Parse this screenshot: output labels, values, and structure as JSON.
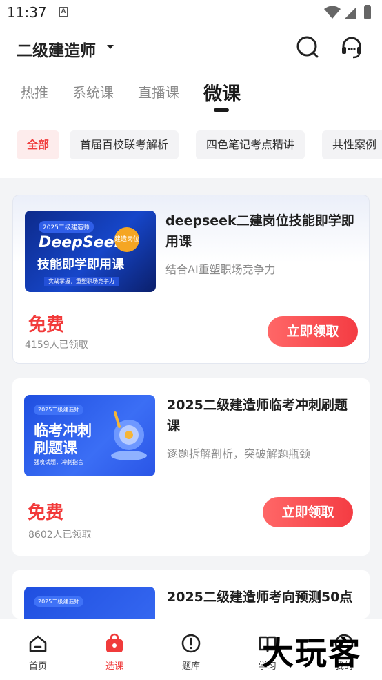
{
  "status_bar": {
    "time": "11:37",
    "notification_icon": "A"
  },
  "header": {
    "title": "二级建造师",
    "search_icon": "search-icon",
    "service_icon": "headset-icon"
  },
  "tabs": [
    {
      "label": "热推",
      "active": false
    },
    {
      "label": "系统课",
      "active": false
    },
    {
      "label": "直播课",
      "active": false
    },
    {
      "label": "微课",
      "active": true
    }
  ],
  "chips": [
    {
      "label": "全部",
      "active": true
    },
    {
      "label": "首届百校联考解析",
      "active": false
    },
    {
      "label": "四色笔记考点精讲",
      "active": false
    },
    {
      "label": "共性案例",
      "active": false
    }
  ],
  "courses": [
    {
      "title": "deepseek二建岗位技能即学即用课",
      "subtitle": "结合AI重塑职场竞争力",
      "price": "免费",
      "count": "4159人已领取",
      "cta": "立即领取",
      "thumb": {
        "tag": "2025二级建造师",
        "line1": "DeepSeek",
        "line2": "技能即学即用课",
        "badge": "建造岗位",
        "footer": "实战掌握，重塑职场竞争力"
      }
    },
    {
      "title": "2025二级建造师临考冲刺刷题课",
      "subtitle": "逐题拆解剖析，突破解题瓶颈",
      "price": "免费",
      "count": "8602人已领取",
      "cta": "立即领取",
      "thumb": {
        "tag": "2025二级建造师",
        "line1": "临考冲刺",
        "line2": "刷题课",
        "footer": "强攻试题，冲刺指言"
      }
    },
    {
      "title": "2025二级建造师考向预测50点",
      "thumb": {
        "tag": "2025二级建造师"
      }
    }
  ],
  "tabbar": [
    {
      "label": "首页",
      "icon": "home-icon",
      "active": false
    },
    {
      "label": "选课",
      "icon": "shopping-bag-icon",
      "active": true
    },
    {
      "label": "题库",
      "icon": "question-bank-icon",
      "active": false
    },
    {
      "label": "学习",
      "icon": "book-icon",
      "active": false
    },
    {
      "label": "我的",
      "icon": "profile-icon",
      "active": false
    }
  ],
  "watermark": "大玩客",
  "colors": {
    "accent": "#f03b3b",
    "tab_active": "#1a1a1a",
    "chip_active_bg": "#fdecec"
  }
}
